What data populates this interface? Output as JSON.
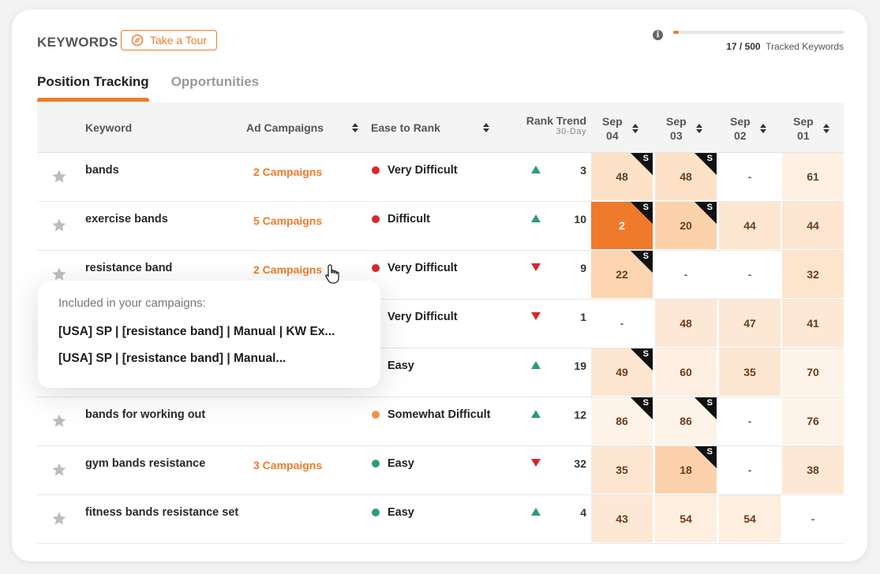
{
  "header": {
    "title": "KEYWORDS",
    "tour_label": "Take a Tour",
    "tracked_current": "17 / 500",
    "tracked_label": "Tracked Keywords",
    "tracked_fraction": 0.034
  },
  "tabs": [
    {
      "label": "Position Tracking",
      "active": true
    },
    {
      "label": "Opportunities",
      "active": false
    }
  ],
  "columns": {
    "keyword": "Keyword",
    "ad_campaigns": "Ad Campaigns",
    "ease": "Ease to Rank",
    "rank_trend": "Rank Trend",
    "rank_trend_sub": "30-Day",
    "dates": [
      {
        "month": "Sep",
        "day": "04"
      },
      {
        "month": "Sep",
        "day": "03"
      },
      {
        "month": "Sep",
        "day": "02"
      },
      {
        "month": "Sep",
        "day": "01"
      }
    ]
  },
  "colors": {
    "accent": "#f07a2b",
    "very_difficult": "#d9262b",
    "difficult": "#d9262b",
    "somewhat_difficult": "#f0944f",
    "easy": "#2e9e6e"
  },
  "rows": [
    {
      "keyword": "bands",
      "campaigns": "2 Campaigns",
      "ease": "Very Difficult",
      "ease_color": "#d9262b",
      "trend": "up",
      "trend_value": "3",
      "cells": [
        {
          "v": "48",
          "bg": "#fde2c8",
          "s": true
        },
        {
          "v": "48",
          "bg": "#fde2c8",
          "s": true
        },
        {
          "v": "-",
          "bg": "#ffffff",
          "s": false
        },
        {
          "v": "61",
          "bg": "#fef1e4",
          "s": false
        }
      ]
    },
    {
      "keyword": "exercise bands",
      "campaigns": "5 Campaigns",
      "ease": "Difficult",
      "ease_color": "#d9262b",
      "trend": "up",
      "trend_value": "10",
      "cells": [
        {
          "v": "2",
          "bg": "#f07a2b",
          "s": true,
          "light": true
        },
        {
          "v": "20",
          "bg": "#fcd2ac",
          "s": true
        },
        {
          "v": "44",
          "bg": "#fde6d1",
          "s": false
        },
        {
          "v": "44",
          "bg": "#fde6d1",
          "s": false
        }
      ]
    },
    {
      "keyword": "resistance band",
      "campaigns": "2 Campaigns",
      "ease": "Very Difficult",
      "ease_color": "#d9262b",
      "trend": "down",
      "trend_value": "9",
      "cells": [
        {
          "v": "22",
          "bg": "#fcd5b1",
          "s": true
        },
        {
          "v": "-",
          "bg": "#ffffff",
          "s": false
        },
        {
          "v": "-",
          "bg": "#ffffff",
          "s": false
        },
        {
          "v": "32",
          "bg": "#fde4cd",
          "s": false
        }
      ]
    },
    {
      "keyword": "",
      "campaigns": "",
      "ease": "Very Difficult",
      "ease_color": "#d9262b",
      "trend": "down",
      "trend_value": "1",
      "cells": [
        {
          "v": "-",
          "bg": "#ffffff",
          "s": false
        },
        {
          "v": "48",
          "bg": "#fde8d5",
          "s": false
        },
        {
          "v": "47",
          "bg": "#fde8d5",
          "s": false
        },
        {
          "v": "41",
          "bg": "#fde8d5",
          "s": false
        }
      ]
    },
    {
      "keyword": "",
      "campaigns": "",
      "ease": "Easy",
      "ease_color": "#2e9e6e",
      "trend": "up",
      "trend_value": "19",
      "cells": [
        {
          "v": "49",
          "bg": "#fde6d1",
          "s": true
        },
        {
          "v": "60",
          "bg": "#fdf0e3",
          "s": false
        },
        {
          "v": "35",
          "bg": "#fde6d1",
          "s": false
        },
        {
          "v": "70",
          "bg": "#fef3e8",
          "s": false
        }
      ]
    },
    {
      "keyword": "bands for working out",
      "campaigns": "",
      "ease": "Somewhat Difficult",
      "ease_color": "#f0944f",
      "trend": "up",
      "trend_value": "12",
      "cells": [
        {
          "v": "86",
          "bg": "#fef3e8",
          "s": true
        },
        {
          "v": "86",
          "bg": "#fef3e8",
          "s": true
        },
        {
          "v": "-",
          "bg": "#ffffff",
          "s": false
        },
        {
          "v": "76",
          "bg": "#fef3e8",
          "s": false
        }
      ]
    },
    {
      "keyword": "gym bands resistance",
      "campaigns": "3 Campaigns",
      "ease": "Easy",
      "ease_color": "#2e9e6e",
      "trend": "down",
      "trend_value": "32",
      "cells": [
        {
          "v": "35",
          "bg": "#fde6d1",
          "s": false
        },
        {
          "v": "18",
          "bg": "#fcd2ac",
          "s": true
        },
        {
          "v": "-",
          "bg": "#ffffff",
          "s": false
        },
        {
          "v": "38",
          "bg": "#fde8d5",
          "s": false
        }
      ]
    },
    {
      "keyword": "fitness bands resistance set",
      "campaigns": "",
      "ease": "Easy",
      "ease_color": "#2e9e6e",
      "trend": "up",
      "trend_value": "4",
      "cells": [
        {
          "v": "43",
          "bg": "#fde8d5",
          "s": false
        },
        {
          "v": "54",
          "bg": "#fdeedf",
          "s": false
        },
        {
          "v": "54",
          "bg": "#fdeedf",
          "s": false
        },
        {
          "v": "-",
          "bg": "#ffffff",
          "s": false
        }
      ]
    }
  ],
  "tooltip": {
    "heading": "Included in your campaigns:",
    "items": [
      "[USA] SP | [resistance band] | Manual | KW Ex...",
      "[USA] SP | [resistance band] | Manual..."
    ]
  }
}
